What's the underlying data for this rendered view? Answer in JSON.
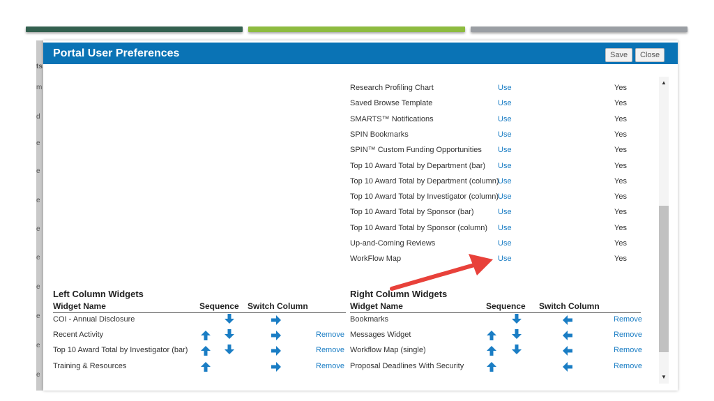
{
  "top_bars": {
    "colors": [
      "#33604f",
      "#8dbb3f",
      "#9a9ea3"
    ]
  },
  "background_fragments": [
    "ts",
    "m",
    "d",
    "e",
    "e",
    "e",
    "e",
    "e",
    "e",
    "e",
    "e",
    "e"
  ],
  "dialog": {
    "title": "Portal User Preferences",
    "save_label": "Save",
    "close_label": "Close",
    "accent_color": "#0a73b5"
  },
  "widget_list": [
    {
      "name": "Research Profiling Chart",
      "action": "Use",
      "status": "Yes"
    },
    {
      "name": "Saved Browse Template",
      "action": "Use",
      "status": "Yes"
    },
    {
      "name": "SMARTS™ Notifications",
      "action": "Use",
      "status": "Yes"
    },
    {
      "name": "SPIN Bookmarks",
      "action": "Use",
      "status": "Yes"
    },
    {
      "name": "SPIN™ Custom Funding Opportunities",
      "action": "Use",
      "status": "Yes"
    },
    {
      "name": "Top 10 Award Total by Department (bar)",
      "action": "Use",
      "status": "Yes"
    },
    {
      "name": "Top 10 Award Total by Department (column)",
      "action": "Use",
      "status": "Yes"
    },
    {
      "name": "Top 10 Award Total by Investigator (column)",
      "action": "Use",
      "status": "Yes"
    },
    {
      "name": "Top 10 Award Total by Sponsor (bar)",
      "action": "Use",
      "status": "Yes"
    },
    {
      "name": "Top 10 Award Total by Sponsor (column)",
      "action": "Use",
      "status": "Yes"
    },
    {
      "name": "Up-and-Coming Reviews",
      "action": "Use",
      "status": "Yes"
    },
    {
      "name": "WorkFlow Map",
      "action": "Use",
      "status": "Yes"
    }
  ],
  "left_column": {
    "title": "Left Column Widgets",
    "headers": {
      "name": "Widget Name",
      "sequence": "Sequence",
      "switch": "Switch Column"
    },
    "rows": [
      {
        "name": "COI - Annual Disclosure",
        "remove": ""
      },
      {
        "name": "Recent Activity",
        "remove": "Remove"
      },
      {
        "name": "Top 10 Award Total by Investigator (bar)",
        "remove": "Remove"
      },
      {
        "name": "Training & Resources",
        "remove": "Remove"
      }
    ]
  },
  "right_column": {
    "title": "Right Column Widgets",
    "headers": {
      "name": "Widget Name",
      "sequence": "Sequence",
      "switch": "Switch Column"
    },
    "rows": [
      {
        "name": "Bookmarks",
        "remove": "Remove"
      },
      {
        "name": "Messages Widget",
        "remove": "Remove"
      },
      {
        "name": "Workflow Map (single)",
        "remove": "Remove"
      },
      {
        "name": "Proposal Deadlines With Security",
        "remove": "Remove"
      }
    ]
  },
  "icons": {
    "up": "arrow-up-icon",
    "down": "arrow-down-icon",
    "right": "arrow-right-icon",
    "left": "arrow-left-icon",
    "icon_color": "#1a7dc4",
    "annotation_color": "#e8413a"
  }
}
